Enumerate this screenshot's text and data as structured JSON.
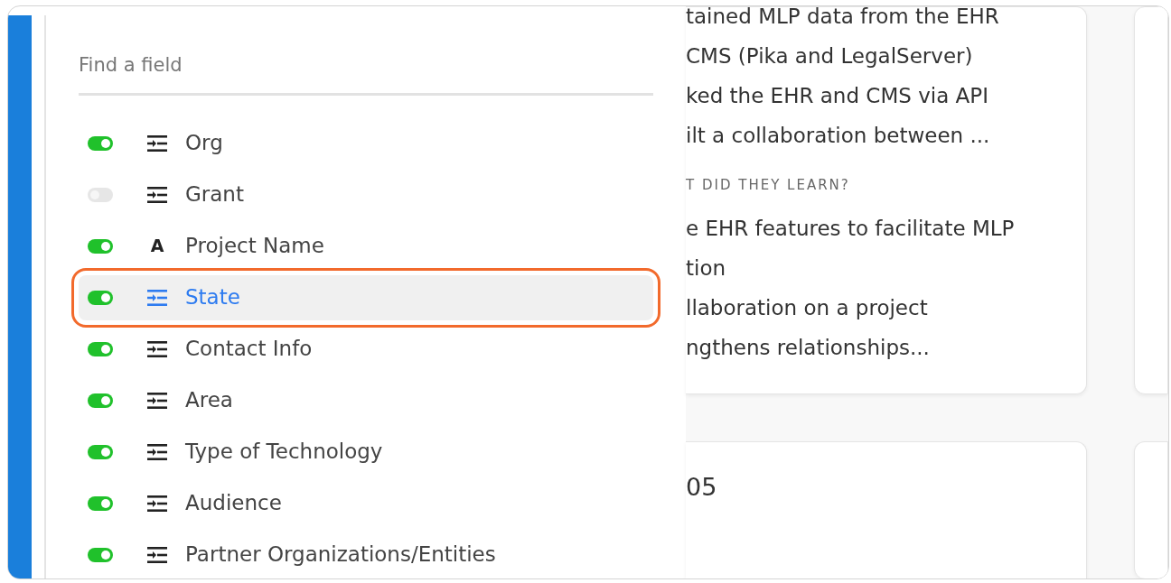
{
  "field_search": {
    "placeholder": "Find a field"
  },
  "fields": [
    {
      "label": "Org",
      "kind": "list",
      "on": true,
      "selected": false
    },
    {
      "label": "Grant",
      "kind": "list",
      "on": false,
      "selected": false
    },
    {
      "label": "Project Name",
      "kind": "text",
      "on": true,
      "selected": false
    },
    {
      "label": "State",
      "kind": "list",
      "on": true,
      "selected": true
    },
    {
      "label": "Contact Info",
      "kind": "list",
      "on": true,
      "selected": false
    },
    {
      "label": "Area",
      "kind": "list",
      "on": true,
      "selected": false
    },
    {
      "label": "Type of Technology",
      "kind": "list",
      "on": true,
      "selected": false
    },
    {
      "label": "Audience",
      "kind": "list",
      "on": true,
      "selected": false
    },
    {
      "label": "Partner Organizations/Entities",
      "kind": "list",
      "on": true,
      "selected": false
    }
  ],
  "text_icon_letter": "A",
  "cards": [
    {
      "lines_top": [
        "tained MLP data from the EHR",
        "CMS (Pika and LegalServer)",
        "ked the EHR and CMS via API",
        "ilt a collaboration between ..."
      ],
      "heading": "T DID THEY LEARN?",
      "lines_bottom": [
        "e EHR features to facilitate MLP",
        "tion",
        "llaboration on a project",
        "ngthens relationships..."
      ]
    },
    {
      "title": "05"
    }
  ]
}
